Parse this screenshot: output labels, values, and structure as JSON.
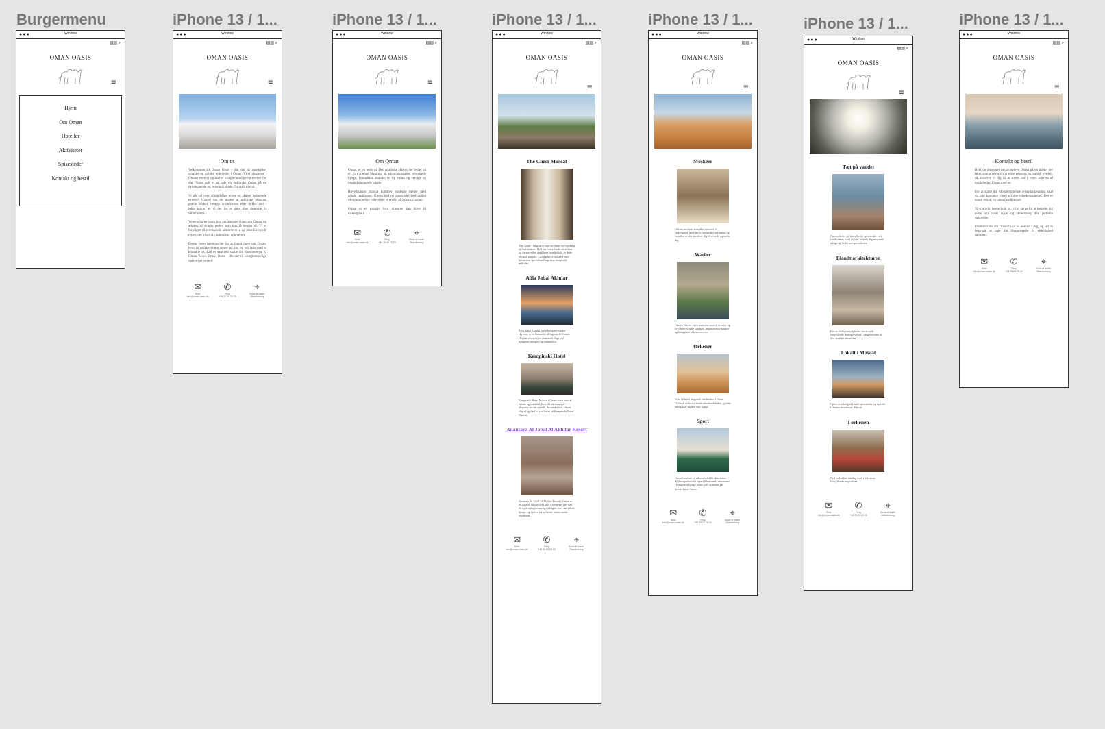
{
  "frames": [
    {
      "title": "Burgermenu"
    },
    {
      "title": "iPhone 13 / 1..."
    },
    {
      "title": "iPhone 13 / 1..."
    },
    {
      "title": "iPhone 13 / 1..."
    },
    {
      "title": "iPhone 13 / 1..."
    },
    {
      "title": "iPhone 13 / 1..."
    },
    {
      "title": "iPhone 13 / 1..."
    }
  ],
  "window": {
    "dots": "●●●",
    "title": "Window",
    "tools": "▤▤ ⌕"
  },
  "brand": "OMAN OASIS",
  "hamburger": "≡",
  "menu": {
    "items": [
      "Hjem",
      "Om Oman",
      "Hoteller",
      "Aktiviteter",
      "Spisesteder",
      "Kontakt og bestil"
    ]
  },
  "om_os": {
    "heading": "Om os",
    "paragraphs": [
      "Velkommen til Oman Oasis - din dør til autentiske, smukke og unikke oplevelser i Oman. Vi er eksperter i Omans eventyr og skaber uforglemmelige oplevelser for dig. Vores mål er at lade dig udforske Oman på en dybdegående og personlig måde, fra start til slut.",
      "Vi går ud over almindelige rejser og skaber betagende eventyr. Uanset om du ønsker at udforske Muscats gamle souker, besøge arkitekturen eller dykke ned i lokal kultur, er vi her for at gøre dine drømme til virkelighed.",
      "Vores erfarne team har omfattende viden om Oman og adgang til skjulte perler, som kun få kender til. Vi er forpligtet til enestående kundeservice og skræddersyede rejser, der giver dig autentiske oplevelser.",
      "Besøg vores hjemmeside for at forstå mere om Oman, hvor de unikke skatte venter på dig, og tøv ikke med at kontakte os. Lad os sammen skabe din drømmerejse til Oman. Vores Oman Oasis - din dør til uforglemmelige oplevelser venter!"
    ]
  },
  "om_oman": {
    "heading": "Om Oman",
    "paragraphs": [
      "Oman, er en perle på Den Arabiske Halvø, der byder på en fortryllende blanding af ørkenlandskaber, storslåede bjerge, fantastiske strande, en rig kultur og venlige og imødekommende lokale.",
      "Hovedstaden Muscat kommer moderne bølger med gamle traditioner. Gæstfrihed og autentiske sædvanlige uforglemmelige oplevelser er en del af Omans charme.",
      "Oman er et paradis hvor drømme kan blive til virkelighed."
    ]
  },
  "hotels": [
    {
      "title": "The Chedi Muscat",
      "text": "The Chedi i Muscat er som en drøm ved bredden af Arabiahavet. Med sin fortryllende arkitektur og varmere den smukkere hotelpalads, er dette et sandt paradis. Lad dig blive forkælet med luksuriøse spa-behandlinger og smagfulde måltider.",
      "link": false
    },
    {
      "title": "Alila Jabal Akhdar",
      "text": "Alila Jabal Akhdar, hvor bjergene møder skyerne, er et fantastisk tilflugtssted i Oman. Her kan du nyde en dramatisk flugt ved bjergenes udsigter og naturens ro.",
      "link": false
    },
    {
      "title": "Kempinski Hotel",
      "text": "Kempinski Hotel Muscat i Oman er en oase af luksus og skønhed, hvor du omfavnes af elegance fra det øjeblik, du træder ind. Oman, slap af og find ro ved havet på Kempinski Hotel Muscat.",
      "link": false
    },
    {
      "title": "Anantara Al Jabal Al Akhdar Resort",
      "text": "Anantara Al Jabal Al Akhdar Resort i Oman er en oase af luksus dybt inde i bjergene. Her kan du nyde uforglemmelige udsigter over storslåede bjerge, og opleve fortryllende nætter under stjernerne.",
      "link": true
    }
  ],
  "activities": [
    {
      "title": "Moskeer",
      "text": "Omans moskeer fortæller historier til virkelighed, med deres fantastiske arkitektur og en indre ro, der inviterer dig til at nyde og undre dig.",
      "h": 72
    },
    {
      "title": "Wadier",
      "text": "Omans Wadier er en naturens oase af eventyr og ro. Oplev skjulte vandløb, imponerende klipper og betagende ørkenscenerier.",
      "h": 82
    },
    {
      "title": "Ørkener",
      "text": "Et af de mest dragende landskaber i Oman. Udforsk de fortryllende ørkenlandskaber, gyldne sandklitter og den rige kultur.",
      "h": 56
    },
    {
      "title": "Sport",
      "text": "Oman inviterer til adrenalinfyldte aktiviteter, dykkeroplevelser i krystalklart vand, vandreture i betagende bjerge, samt golf og tennis på førsteklasses baner.",
      "h": 64
    }
  ],
  "restaurants": [
    {
      "title": "Tæt på vandet",
      "text": "Omans byder på fortryllende spisesteder ved vandkanten, hvor du kan forkæle dig selv med udsigt og friske havspecialiteter.",
      "h": 82
    },
    {
      "title": "Blandt arkitekturen",
      "text": "Der er utallige muligheder for at nyde fortryllende madoplevelser i omgivelserne af den smukke arkitektur.",
      "h": 88
    },
    {
      "title": "Lokalt i Muscat",
      "text": "Oplev et udvalg af lokale spisesteder og nyd det i Omans hovedstad, Muscat.",
      "h": 56
    },
    {
      "title": "I ørkenen",
      "text": "Nyd en lækker middag midt i ørkenens fortryllende omgivelser.",
      "h": 62
    }
  ],
  "kontakt": {
    "heading": "Kontakt og bestil",
    "paragraphs": [
      "Hvis du drømmer om at opleve Oman på en måde, der føles som en eventyrlig rejse gennem en magisk verden, så inviterer vi dig til at træde ind i vores univers af muligheder. Drøm med os.",
      "For at starte din uforglemmelige rejseplanlægning, skal du blot kontakte vores erfarne rejsekonsulenter. Det er nemt, enkelt og uden forpligtelser.",
      "Så snart din besked når os, vil vi sørge for at fortælle dig mere om vores rejser og skræddersy den perfekte oplevelse.",
      "Drømmer du om Oman? Giv os besked i dag, og lad os begynde at tage din drømmerejse til virkelighed sammen."
    ]
  },
  "footer": [
    {
      "icon": "✉",
      "label": "Skriv",
      "value": "info@oman-oasis.dk"
    },
    {
      "icon": "✆",
      "label": "Ring",
      "value": "+45 20 20 20 20"
    },
    {
      "icon": "⌖",
      "label": "Book et møde",
      "value": "Skanderborg"
    }
  ],
  "colors": {
    "background": "#e5e5e5",
    "frame_border": "#333333",
    "link": "#7c4dd8"
  }
}
